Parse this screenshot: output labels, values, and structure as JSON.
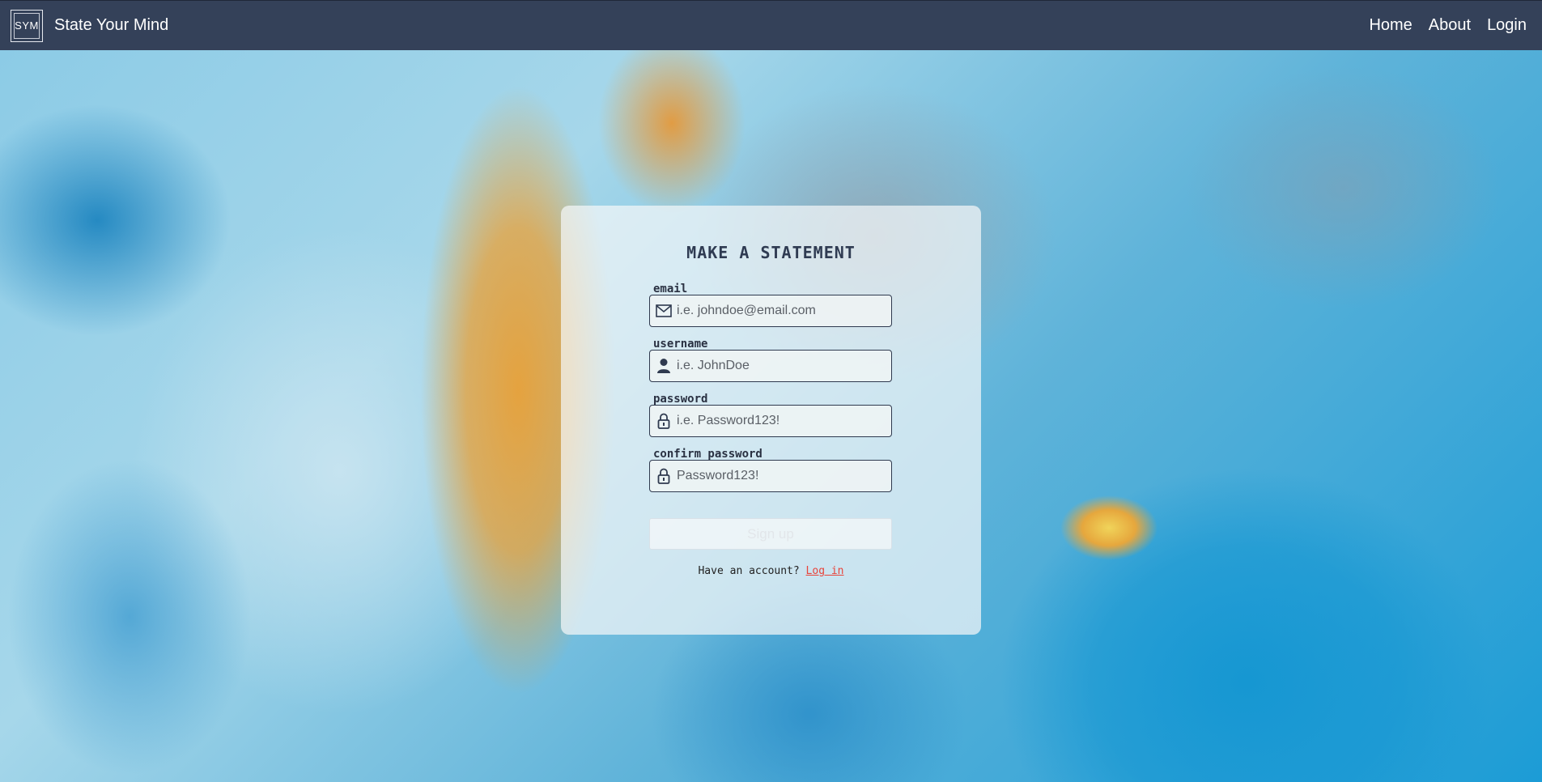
{
  "navbar": {
    "logo_text": "SYM",
    "brand_name": "State Your Mind",
    "links": [
      "Home",
      "About",
      "Login"
    ]
  },
  "form": {
    "title": "MAKE A STATEMENT",
    "fields": [
      {
        "label": "email",
        "placeholder": "i.e. johndoe@email.com",
        "icon": "envelope-icon"
      },
      {
        "label": "username",
        "placeholder": "i.e. JohnDoe",
        "icon": "user-icon"
      },
      {
        "label": "password",
        "placeholder": "i.e. Password123!",
        "icon": "lock-icon"
      },
      {
        "label": "confirm password",
        "placeholder": "Password123!",
        "icon": "lock-icon"
      }
    ],
    "submit_label": "Sign up",
    "account_prompt": "Have an account?",
    "login_link": "Log in"
  },
  "colors": {
    "navbar_bg": "#344159",
    "link_accent": "#e8433a"
  }
}
